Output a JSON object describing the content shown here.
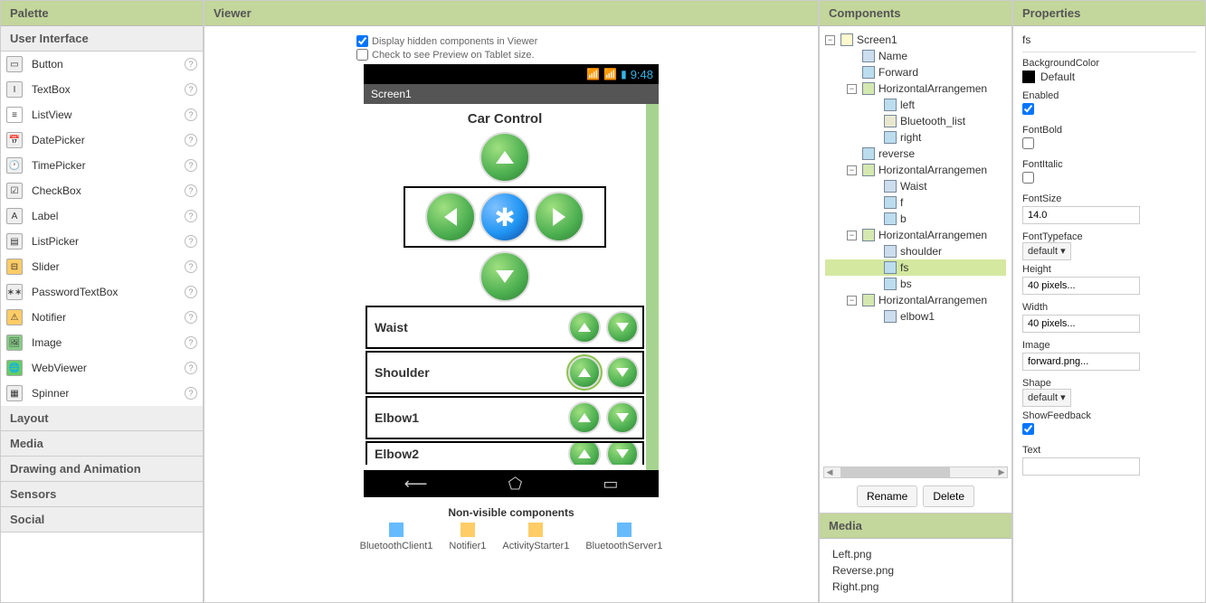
{
  "palette": {
    "title": "Palette",
    "sections": {
      "userInterface": "User Interface",
      "layout": "Layout",
      "media": "Media",
      "drawing": "Drawing and Animation",
      "sensors": "Sensors",
      "social": "Social"
    },
    "items": [
      "Button",
      "TextBox",
      "ListView",
      "DatePicker",
      "TimePicker",
      "CheckBox",
      "Label",
      "ListPicker",
      "Slider",
      "PasswordTextBox",
      "Notifier",
      "Image",
      "WebViewer",
      "Spinner"
    ]
  },
  "viewer": {
    "title": "Viewer",
    "check1": "Display hidden components in Viewer",
    "check2": "Check to see Preview on Tablet size.",
    "time": "9:48",
    "screenTitle": "Screen1",
    "appTitle": "Car Control",
    "joints": [
      "Waist",
      "Shoulder",
      "Elbow1",
      "Elbow2"
    ],
    "nonvisTitle": "Non-visible components",
    "nonvis": [
      "BluetoothClient1",
      "Notifier1",
      "ActivityStarter1",
      "BluetoothServer1"
    ]
  },
  "components": {
    "title": "Components",
    "rename": "Rename",
    "delete": "Delete",
    "tree": {
      "screen1": "Screen1",
      "name": "Name",
      "forward": "Forward",
      "ha1": "HorizontalArrangemen",
      "left": "left",
      "btlist": "Bluetooth_list",
      "right": "right",
      "reverse": "reverse",
      "ha2": "HorizontalArrangemen",
      "waist": "Waist",
      "f": "f",
      "b": "b",
      "ha3": "HorizontalArrangemen",
      "shoulder": "shoulder",
      "fs": "fs",
      "bs": "bs",
      "ha4": "HorizontalArrangemen",
      "elbow1": "elbow1"
    },
    "mediaTitle": "Media",
    "mediaFiles": [
      "Left.png",
      "Reverse.png",
      "Right.png"
    ]
  },
  "properties": {
    "title": "Properties",
    "selected": "fs",
    "bgColorLabel": "BackgroundColor",
    "bgColorVal": "Default",
    "enabledLabel": "Enabled",
    "fontBoldLabel": "FontBold",
    "fontItalicLabel": "FontItalic",
    "fontSizeLabel": "FontSize",
    "fontSizeVal": "14.0",
    "fontTypefaceLabel": "FontTypeface",
    "fontTypefaceVal": "default",
    "heightLabel": "Height",
    "heightVal": "40 pixels...",
    "widthLabel": "Width",
    "widthVal": "40 pixels...",
    "imageLabel": "Image",
    "imageVal": "forward.png...",
    "shapeLabel": "Shape",
    "shapeVal": "default",
    "showFeedbackLabel": "ShowFeedback",
    "textLabel": "Text"
  }
}
